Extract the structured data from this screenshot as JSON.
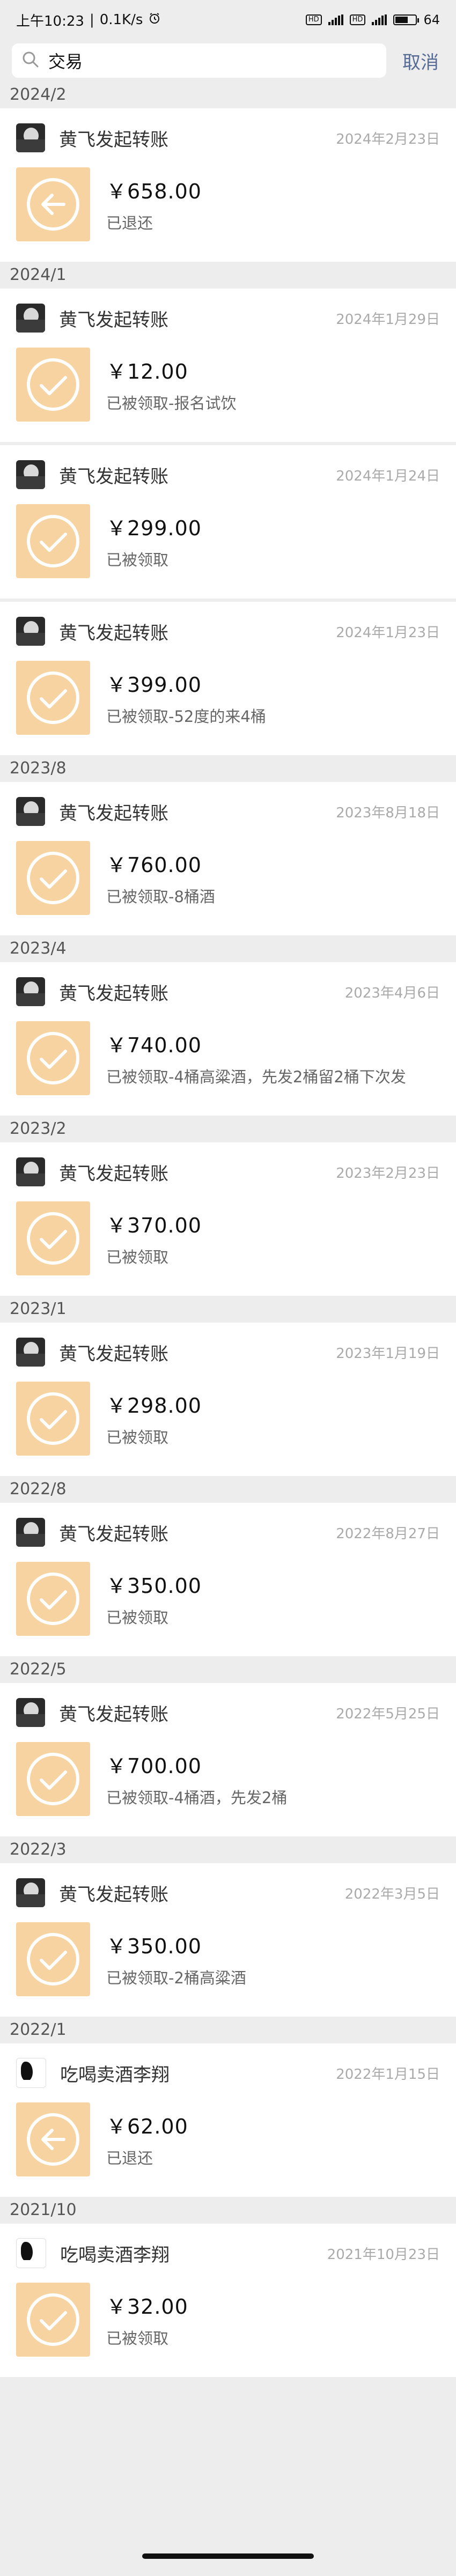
{
  "status_bar": {
    "time": "上午10:23",
    "network_speed": "0.1K/s",
    "alarm_icon": "alarm-clock-icon",
    "sim1_label": "HD",
    "sim2_label": "HD",
    "battery_text": "64",
    "battery_fraction": 0.64
  },
  "search": {
    "value": "交易",
    "cancel_label": "取消"
  },
  "groups": [
    {
      "header": "2024/2",
      "items": [
        {
          "sender": "黄飞发起转账",
          "date": "2024年2月23日",
          "amount": "￥658.00",
          "status": "已退还",
          "icon": "return-arrow-icon",
          "avatar": "avatar-photo"
        }
      ]
    },
    {
      "header": "2024/1",
      "items": [
        {
          "sender": "黄飞发起转账",
          "date": "2024年1月29日",
          "amount": "￥12.00",
          "status": "已被领取-报名试饮",
          "icon": "check-circle-icon",
          "avatar": "avatar-photo"
        },
        {
          "sender": "黄飞发起转账",
          "date": "2024年1月24日",
          "amount": "￥299.00",
          "status": "已被领取",
          "icon": "check-circle-icon",
          "avatar": "avatar-photo"
        },
        {
          "sender": "黄飞发起转账",
          "date": "2024年1月23日",
          "amount": "￥399.00",
          "status": "已被领取-52度的来4桶",
          "icon": "check-circle-icon",
          "avatar": "avatar-photo"
        }
      ]
    },
    {
      "header": "2023/8",
      "items": [
        {
          "sender": "黄飞发起转账",
          "date": "2023年8月18日",
          "amount": "￥760.00",
          "status": "已被领取-8桶酒",
          "icon": "check-circle-icon",
          "avatar": "avatar-photo"
        }
      ]
    },
    {
      "header": "2023/4",
      "items": [
        {
          "sender": "黄飞发起转账",
          "date": "2023年4月6日",
          "amount": "￥740.00",
          "status": "已被领取-4桶高粱酒，先发2桶留2桶下次发",
          "icon": "check-circle-icon",
          "avatar": "avatar-photo"
        }
      ]
    },
    {
      "header": "2023/2",
      "items": [
        {
          "sender": "黄飞发起转账",
          "date": "2023年2月23日",
          "amount": "￥370.00",
          "status": "已被领取",
          "icon": "check-circle-icon",
          "avatar": "avatar-photo"
        }
      ]
    },
    {
      "header": "2023/1",
      "items": [
        {
          "sender": "黄飞发起转账",
          "date": "2023年1月19日",
          "amount": "￥298.00",
          "status": "已被领取",
          "icon": "check-circle-icon",
          "avatar": "avatar-photo"
        }
      ]
    },
    {
      "header": "2022/8",
      "items": [
        {
          "sender": "黄飞发起转账",
          "date": "2022年8月27日",
          "amount": "￥350.00",
          "status": "已被领取",
          "icon": "check-circle-icon",
          "avatar": "avatar-photo"
        }
      ]
    },
    {
      "header": "2022/5",
      "items": [
        {
          "sender": "黄飞发起转账",
          "date": "2022年5月25日",
          "amount": "￥700.00",
          "status": "已被领取-4桶酒，先发2桶",
          "icon": "check-circle-icon",
          "avatar": "avatar-photo"
        }
      ]
    },
    {
      "header": "2022/3",
      "items": [
        {
          "sender": "黄飞发起转账",
          "date": "2022年3月5日",
          "amount": "￥350.00",
          "status": "已被领取-2桶高粱酒",
          "icon": "check-circle-icon",
          "avatar": "avatar-photo"
        }
      ]
    },
    {
      "header": "2022/1",
      "items": [
        {
          "sender": "吃喝卖酒李翔",
          "date": "2022年1月15日",
          "amount": "￥62.00",
          "status": "已退还",
          "icon": "return-arrow-icon",
          "avatar": "avatar-drawing"
        }
      ]
    },
    {
      "header": "2021/10",
      "items": [
        {
          "sender": "吃喝卖酒李翔",
          "date": "2021年10月23日",
          "amount": "￥32.00",
          "status": "已被领取",
          "icon": "check-circle-icon",
          "avatar": "avatar-drawing"
        }
      ]
    }
  ]
}
